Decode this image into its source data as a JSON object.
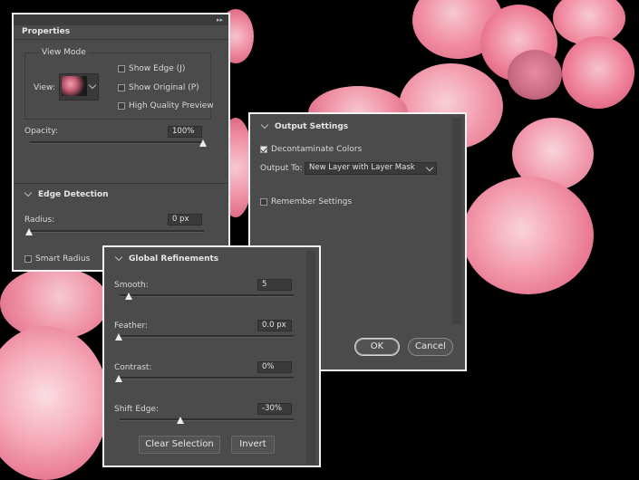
{
  "properties": {
    "header_title": "Properties",
    "view_mode": {
      "title": "View Mode",
      "view_label": "View:",
      "show_edge": {
        "label": "Show Edge (J)",
        "checked": false
      },
      "show_original": {
        "label": "Show Original (P)",
        "checked": false
      },
      "high_quality": {
        "label": "High Quality Preview",
        "checked": false
      }
    },
    "opacity": {
      "label": "Opacity:",
      "value": "100%",
      "level": 1.0
    },
    "edge_detection": {
      "title": "Edge Detection",
      "radius": {
        "label": "Radius:",
        "value": "0 px",
        "level": 0.0
      },
      "smart_radius": {
        "label": "Smart Radius",
        "checked": false
      }
    }
  },
  "output": {
    "title": "Output Settings",
    "decontaminate": {
      "label": "Decontaminate Colors",
      "checked": true
    },
    "output_to_label": "Output To:",
    "output_to_value": "New Layer with Layer Mask",
    "remember": {
      "label": "Remember Settings",
      "checked": false
    },
    "ok_label": "OK",
    "cancel_label": "Cancel"
  },
  "global": {
    "title": "Global Refinements",
    "smooth": {
      "label": "Smooth:",
      "value": "5",
      "level": 0.05
    },
    "feather": {
      "label": "Feather:",
      "value": "0.0 px",
      "level": 0.0
    },
    "contrast": {
      "label": "Contrast:",
      "value": "0%",
      "level": 0.0
    },
    "shift_edge": {
      "label": "Shift Edge:",
      "value": "-30%",
      "level": 0.35
    },
    "clear_selection_label": "Clear Selection",
    "invert_label": "Invert"
  },
  "colors": {
    "panel": "#4b4b4b",
    "background": "#000000",
    "rose": "#f08a9f"
  }
}
